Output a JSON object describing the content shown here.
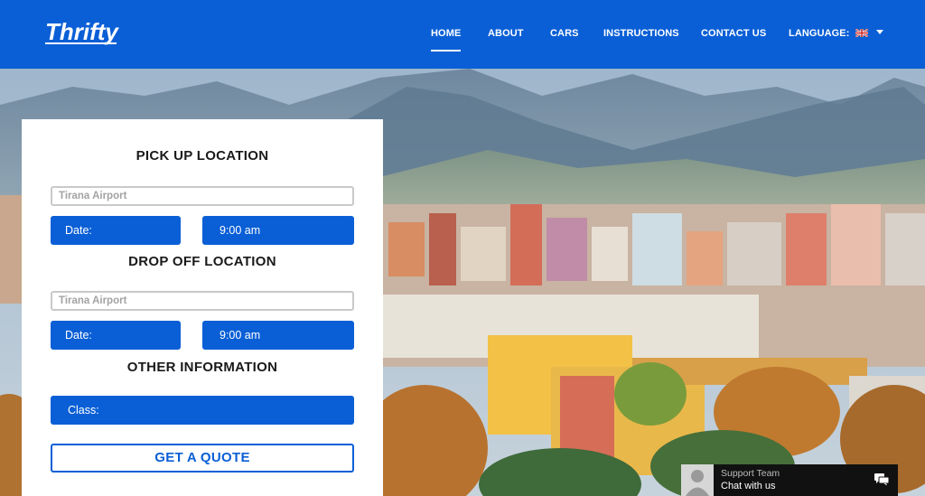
{
  "brand": {
    "logo_text": "Thrifty"
  },
  "nav": {
    "items": [
      {
        "label": "HOME",
        "active": true
      },
      {
        "label": "ABOUT",
        "active": false
      },
      {
        "label": "CARS",
        "active": false
      },
      {
        "label": "INSTRUCTIONS",
        "active": false
      },
      {
        "label": "CONTACT US",
        "active": false
      }
    ],
    "language_label": "LANGUAGE:",
    "language_flag": "uk-flag-icon"
  },
  "booking": {
    "pickup": {
      "title": "PICK UP LOCATION",
      "location_placeholder": "Tirana Airport",
      "date_label": "Date:",
      "time_value": "9:00 am"
    },
    "dropoff": {
      "title": "DROP OFF LOCATION",
      "location_placeholder": "Tirana Airport",
      "date_label": "Date:",
      "time_value": "9:00 am"
    },
    "other": {
      "title": "OTHER INFORMATION",
      "class_label": "Class:"
    },
    "quote_button": "GET A QUOTE"
  },
  "chat": {
    "team_label": "Support Team",
    "cta_label": "Chat with us",
    "icon": "chat-bubble-icon"
  },
  "colors": {
    "brand_blue": "#0a5fd6",
    "white": "#ffffff",
    "chat_bg": "#111111"
  }
}
